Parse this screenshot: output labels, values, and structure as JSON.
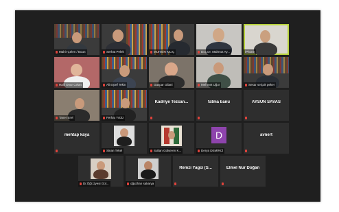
{
  "participants": [
    {
      "name": "Mahir Çelen / Boun"
    },
    {
      "name": "Serhat Pelek"
    },
    {
      "name": "MUHSİN KILIÇ"
    },
    {
      "name": "Doç.Dr. Mahmut Ay..."
    },
    {
      "name": "iPhone"
    },
    {
      "name": "Halil Onur Celan"
    },
    {
      "name": "Ali Eşref Tekin"
    },
    {
      "name": "Gaspar Gilani"
    },
    {
      "name": "Mehmet Uğur"
    },
    {
      "name": "Sesar selçuk peker"
    },
    {
      "name": "Taner Erel"
    },
    {
      "name": "Ferhat Yıldız"
    },
    {
      "name": "Kadriye Tezcan..."
    },
    {
      "name": "fatma banu"
    },
    {
      "name": "AYSUN SAVAS"
    },
    {
      "name": "mehtap kaya"
    },
    {
      "name": "Sinan Tekel"
    },
    {
      "name": "Sultan Gülseren K..."
    },
    {
      "name": "Derya DEMİRCİ"
    },
    {
      "name": "avnert"
    },
    {
      "name": "Dr.Öğr.Üyesi Gül..."
    },
    {
      "name": "oğuzhan sakarya"
    },
    {
      "name": "Remzi Yagci (S..."
    },
    {
      "name": "Elmel Nur Doğan"
    }
  ],
  "avatar_letter": "D",
  "colors": {
    "active_speaker": "#b8d23c",
    "muted_mic": "#e0433b",
    "avatar": "#8e44ad"
  }
}
